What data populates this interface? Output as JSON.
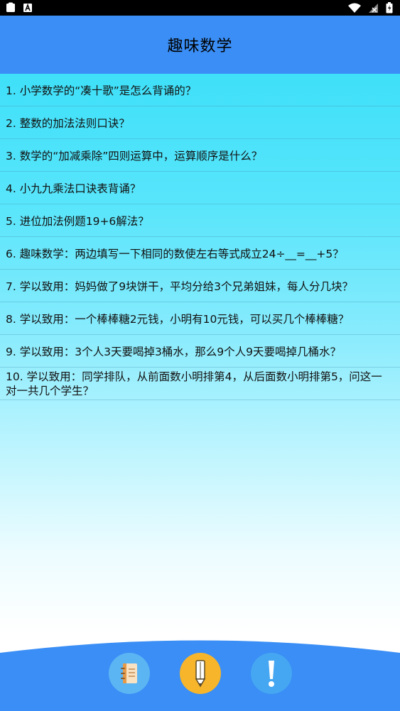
{
  "header": {
    "title": "趣味数学"
  },
  "questions": [
    "1. 小学数学的“凑十歌”是怎么背诵的？",
    "2. 整数的加法法则口诀？",
    "3. 数学的“加减乘除”四则运算中，运算顺序是什么？",
    "4. 小九九乘法口诀表背诵？",
    "5. 进位加法例题19+6解法？",
    "6. 趣味数学：两边填写一下相同的数使左右等式成立24÷__=__+5？",
    "7. 学以致用：妈妈做了9块饼干，平均分给3个兄弟姐妹，每人分几块？",
    "8. 学以致用：一个棒棒糖2元钱，小明有10元钱，可以买几个棒棒糖？",
    "9. 学以致用：3个人3天要喝掉3桶水，那么9个人9天要喝掉几桶水？",
    "10. 学以致用：同学排队，从前面数小明排第4，从后面数小明排第5，问这一对一共几个学生？"
  ],
  "bottom_nav": [
    {
      "icon": "notebook-icon",
      "color": "#5bb5f3"
    },
    {
      "icon": "pencil-icon",
      "color": "#f7b52c"
    },
    {
      "icon": "exclamation-icon",
      "color": "#45a7f2"
    }
  ],
  "colors": {
    "header": "#3a8ef5",
    "list_top": "#3fe0f9",
    "wave": "#3a8ef5"
  }
}
